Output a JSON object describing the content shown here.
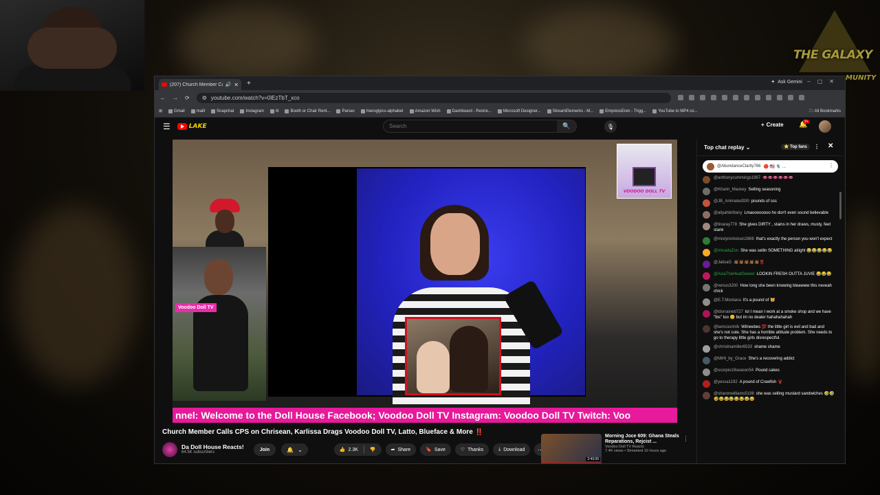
{
  "overlay": {
    "brand_line1": "THE GALAXY",
    "brand_line2": "MUNITY"
  },
  "browser": {
    "tab_title": "(207) Church Member Calls",
    "ask_gemini": "Ask Gemini",
    "url": "youtube.com/watch?v=0lEzTbT_xco",
    "bookmarks": [
      "Gmail",
      "maill",
      "Snapchat",
      "Instagram",
      "lit",
      "Booth or Chair Rent...",
      "Parsec",
      "hieroglyics-alphabet",
      "Amazon Wish",
      "Dashboard - Restre...",
      "Microsoft Designer...",
      "StreamElements - M...",
      "EmpressEren - Trigg...",
      "YouTube to MP4 co..."
    ],
    "all_bookmarks": "All Bookmarks"
  },
  "youtube": {
    "search_placeholder": "Search",
    "create_label": "Create",
    "notif_count": "9+",
    "doodle_text": "LAKE"
  },
  "video": {
    "ticker_text": "nnel: Welcome to the Doll House Facebook; Voodoo Doll TV Instagram: Voodoo Doll TV Twitch: Voo",
    "nametag": "Voodoo Doll TV",
    "logo_text": "VOODOO DOLL TV",
    "title": "Church Member Calls CPS on Chrisean, Karlissa Drags Voodoo Doll TV, Latto, Blueface & More",
    "title_flag": "‼️"
  },
  "channel": {
    "name": "Da Doll House Reacts!",
    "subscribers": "64.5K subscribers",
    "join_label": "Join"
  },
  "actions": {
    "likes": "2.3K",
    "share": "Share",
    "save": "Save",
    "thanks": "Thanks",
    "download": "Download"
  },
  "recommended": {
    "title": "Morning Joce 609: Ghana Steals Reparations, Rejcist ...",
    "channel": "Voodoo Doll TV Reacts",
    "meta": "7.4K views • Streamed 10 hours ago",
    "duration": "2:43:30"
  },
  "chat": {
    "header": "Top chat replay",
    "top_fans": "Top fans",
    "pinned_user": "@AbundanceClarity786",
    "pinned_text": "🔴 🇺🇸 🎙️ ...",
    "messages": [
      {
        "author": "@anthonycummings1967",
        "text": "👄👄👄👄👄👄",
        "color": "#7b4b2a",
        "member": false
      },
      {
        "author": "@Kharin_Mackey",
        "text": "Selling seasoning",
        "color": "#6d6d6d",
        "member": false
      },
      {
        "author": "@JB_Animated330",
        "text": "pounds of sss",
        "color": "#c4523b",
        "member": false
      },
      {
        "author": "@aliyahbrittany",
        "text": "Lmaoooooooo ho don't even sound believable",
        "color": "#8d6e63",
        "member": false
      },
      {
        "author": "@tinaray778",
        "text": "She gives DIRTY , stains in her draws, musty, feet stank",
        "color": "#a1887f",
        "member": false
      },
      {
        "author": "@mistynicholson2866",
        "text": "that's exactly the person you won't expect",
        "color": "#2e7d32",
        "member": false
      },
      {
        "author": "@ImvadaZon",
        "text": "She was sellin SOMETHING alright 😂😂😂😂😂",
        "color": "#f9a825",
        "member": true
      },
      {
        "author": "@JalisaG",
        "text": "👏🏾👏🏾👏🏾👏🏾👏🏾‼️",
        "color": "#6a1b9a",
        "member": false
      },
      {
        "author": "@AsiaTheHeatSeeker",
        "text": "LOOKIN FRESH OUTTA JUVIE 😂😂😂",
        "color": "#c2185b",
        "member": true
      },
      {
        "author": "@venus3200",
        "text": "How long she been knowing bleawww this neveah chick",
        "color": "#757575",
        "member": false
      },
      {
        "author": "@E.T.Montana",
        "text": "It's a pound of 😼",
        "color": "#8e8e8e",
        "member": false
      },
      {
        "author": "@ldorraineb727",
        "text": "lol I mean I work at a smoke shop and we have \"lbs\" too 😊 but im no dealer hahahahahah",
        "color": "#ad1457",
        "member": false
      },
      {
        "author": "@lamcourtnib",
        "text": "Wilneebes 💯 the little girl is evil and bad and she's not cute. She has a horrible attitude problem. She needs to go to therapy little girls disrespectful.",
        "color": "#4e342e",
        "member": false
      },
      {
        "author": "@christinamiller6533",
        "text": "shame shame",
        "color": "#9e9e9e",
        "member": false
      },
      {
        "author": "@MiHi_by_Grace",
        "text": "She's a recovering addict",
        "color": "#455a64",
        "member": false
      },
      {
        "author": "@scorpio19season54",
        "text": "Pound cakes",
        "color": "#8d8d8d",
        "member": false
      },
      {
        "author": "@yessa1192",
        "text": "A pound of Crawfish 🦞",
        "color": "#b71c1c",
        "member": false
      },
      {
        "author": "@sharonwilliams5198",
        "text": "she was selling mustard sandwiches 🤣🤣🤣😂😂😂😂😂😂😂",
        "color": "#5d4037",
        "member": false
      }
    ]
  }
}
